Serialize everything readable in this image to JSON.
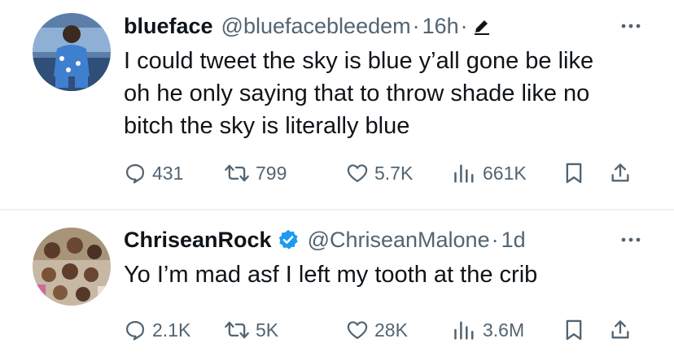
{
  "tweets": [
    {
      "display_name": "blueface",
      "handle": "@bluefacebleedem",
      "separator": "·",
      "time": "16h",
      "separator2": "·",
      "text_lines": [
        "I could tweet the sky is blue y’all gone be like",
        "oh he only saying that to throw shade like no",
        "bitch the sky is literally  blue"
      ],
      "replies": "431",
      "retweets": "799",
      "likes": "5.7K",
      "views": "661K",
      "icons": [
        "avatar",
        "edit-icon",
        "more-icon",
        "reply-icon",
        "retweet-icon",
        "like-icon",
        "views-icon",
        "bookmark-icon",
        "share-icon"
      ]
    },
    {
      "display_name": "ChriseanRock",
      "handle": "@ChriseanMalone",
      "separator": "·",
      "time": "1d",
      "text_lines": [
        "Yo I’m mad asf I left my tooth at the crib"
      ],
      "replies": "2.1K",
      "retweets": "5K",
      "likes": "28K",
      "views": "3.6M",
      "icons": [
        "avatar",
        "verified-icon",
        "more-icon",
        "reply-icon",
        "retweet-icon",
        "like-icon",
        "views-icon",
        "bookmark-icon",
        "share-icon"
      ]
    }
  ],
  "colors": {
    "text": "#0f1419",
    "secondary": "#536471",
    "verified": "#1d9bf0",
    "divider": "#eff3f4"
  }
}
